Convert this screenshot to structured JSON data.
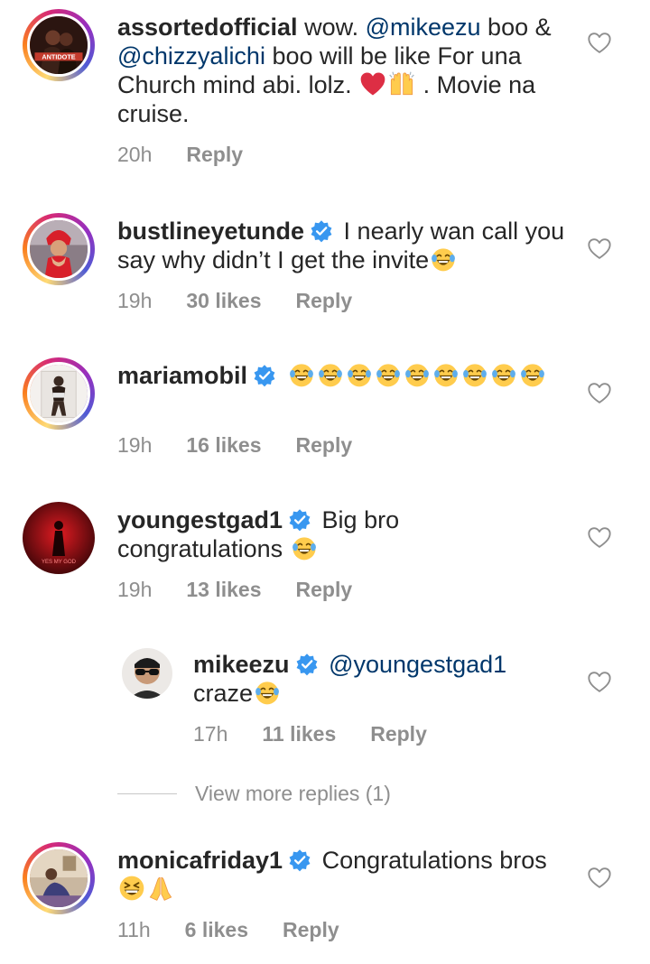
{
  "comments": [
    {
      "username": "assortedofficial",
      "text_parts": [
        " wow.  ",
        "@mikeezu",
        " boo & ",
        "@chizzyalichi",
        " boo will be like For una Church mind abi. lolz. ",
        "",
        " . Movie na cruise."
      ],
      "time": "20h",
      "likes": "",
      "reply": "Reply"
    },
    {
      "username": "bustlineyetunde",
      "text": "I nearly wan call you say why didn’t I get the invite",
      "time": "19h",
      "likes": "30 likes",
      "reply": "Reply"
    },
    {
      "username": "mariamobil",
      "text": "",
      "time": "19h",
      "likes": "16 likes",
      "reply": "Reply"
    },
    {
      "username": "youngestgad1",
      "text": "Big bro congratulations",
      "time": "19h",
      "likes": "13 likes",
      "reply": "Reply"
    },
    {
      "username": "mikeezu",
      "mention": "@youngestgad1",
      "text": "craze",
      "time": "17h",
      "likes": "11 likes",
      "reply": "Reply"
    },
    {
      "username": "monicafriday1",
      "text": "Congratulations bros",
      "time": "11h",
      "likes": "6 likes",
      "reply": "Reply"
    }
  ],
  "view_more_replies": "View more replies (1)",
  "colors": {
    "text": "#262626",
    "muted": "#8e8e8e",
    "mention": "#00376b",
    "verified": "#3897f0"
  },
  "icons": {
    "like": "heart-outline-icon",
    "verified": "verified-badge-icon",
    "laugh": "face-with-tears-of-joy-emoji",
    "grin": "grinning-squinting-emoji",
    "heart_emoji": "red-heart-emoji",
    "raised_hands": "raising-hands-emoji",
    "folded_hands": "folded-hands-emoji"
  }
}
